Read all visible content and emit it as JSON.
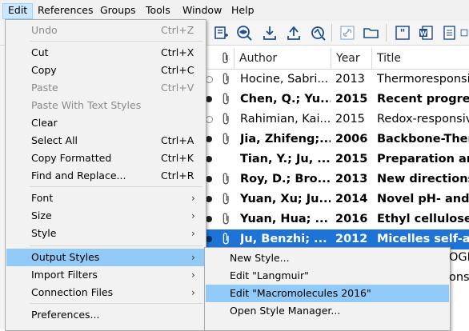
{
  "menubar": {
    "items": [
      "Edit",
      "References",
      "Groups",
      "Tools",
      "Window",
      "Help"
    ]
  },
  "edit_menu": {
    "items": [
      {
        "label": "Undo",
        "shortcut": "Ctrl+Z",
        "disabled": true
      },
      {
        "label": "Cut",
        "shortcut": "Ctrl+X",
        "disabled": false
      },
      {
        "label": "Copy",
        "shortcut": "Ctrl+C",
        "disabled": false
      },
      {
        "label": "Paste",
        "shortcut": "Ctrl+V",
        "disabled": true
      },
      {
        "label": "Paste With Text Styles",
        "shortcut": "",
        "disabled": true
      },
      {
        "label": "Clear",
        "shortcut": "",
        "disabled": false
      },
      {
        "label": "Select All",
        "shortcut": "Ctrl+A",
        "disabled": false
      },
      {
        "label": "Copy Formatted",
        "shortcut": "Ctrl+K",
        "disabled": false
      },
      {
        "label": "Find and Replace...",
        "shortcut": "Ctrl+R",
        "disabled": false
      },
      {
        "label": "Font",
        "submenu": true
      },
      {
        "label": "Size",
        "submenu": true
      },
      {
        "label": "Style",
        "submenu": true
      },
      {
        "label": "Output Styles",
        "submenu": true,
        "highlighted": true
      },
      {
        "label": "Import Filters",
        "submenu": true
      },
      {
        "label": "Connection Files",
        "submenu": true
      },
      {
        "label": "Preferences..."
      }
    ]
  },
  "output_styles_submenu": {
    "items": [
      {
        "label": "New Style..."
      },
      {
        "label": "Edit \"Langmuir\""
      },
      {
        "label": "Edit \"Macromolecules 2016\"",
        "highlighted": true
      },
      {
        "label": "Open Style Manager..."
      }
    ]
  },
  "table": {
    "columns": [
      "Author",
      "Year",
      "Title"
    ],
    "rows": [
      {
        "read": true,
        "attachment": true,
        "author": "Hocine, Sabri...",
        "year": "2013",
        "title": "Thermoresponsive",
        "bold": false
      },
      {
        "read": false,
        "attachment": true,
        "author": "Chen, Q.; Yu...",
        "year": "2015",
        "title": "Recent progress",
        "bold": true
      },
      {
        "read": true,
        "attachment": true,
        "author": "Rahimian, Kai...",
        "year": "2015",
        "title": "Redox-responsive",
        "bold": false
      },
      {
        "read": false,
        "attachment": true,
        "author": "Jia, Zhifeng;...",
        "year": "2006",
        "title": "Backbone-Ther",
        "bold": true
      },
      {
        "read": false,
        "attachment": false,
        "author": "Tian, Y.; Ju, ...",
        "year": "2015",
        "title": "Preparation and",
        "bold": true
      },
      {
        "read": false,
        "attachment": true,
        "author": "Roy, D.; Bro...",
        "year": "2013",
        "title": "New directions",
        "bold": true
      },
      {
        "read": false,
        "attachment": true,
        "author": "Yuan, Xu; Ju...",
        "year": "2014",
        "title": "Novel pH- and",
        "bold": true
      },
      {
        "read": false,
        "attachment": true,
        "author": "Yuan, Hua; ...",
        "year": "2016",
        "title": "Ethyl cellulose",
        "bold": true
      },
      {
        "read": false,
        "attachment": true,
        "author": "Ju, Benzhi; ...",
        "year": "2012",
        "title": "Micelles self-as",
        "bold": true,
        "selected": true
      }
    ],
    "partial_right": [
      "OGI",
      "ons"
    ]
  },
  "colors": {
    "selection": "#1e73d6",
    "menu_highlight": "#91c9f7",
    "menubar_active": "#cce8ff"
  }
}
